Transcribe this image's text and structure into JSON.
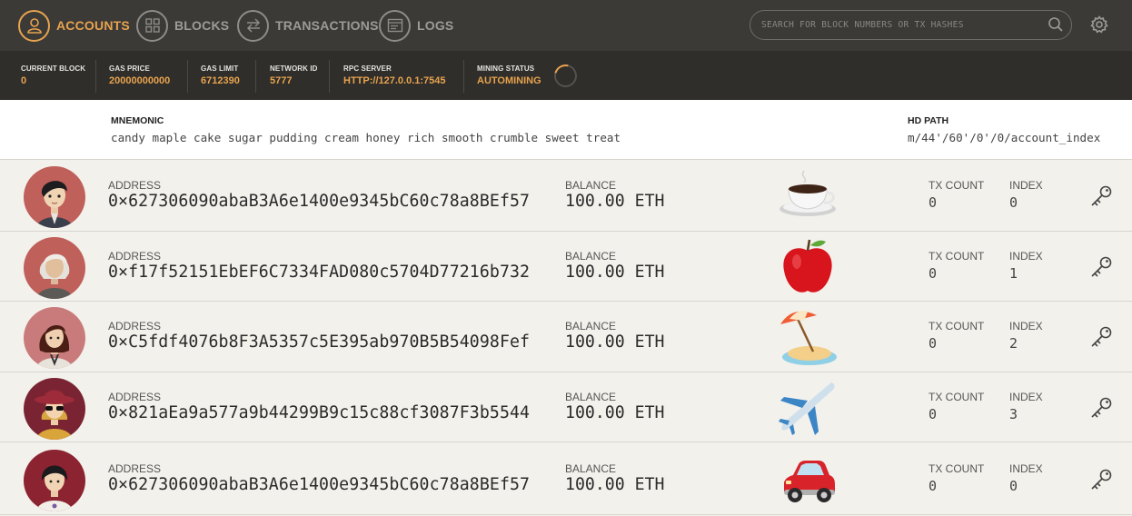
{
  "nav": {
    "accounts": "ACCOUNTS",
    "blocks": "BLOCKS",
    "transactions": "TRANSACTIONS",
    "logs": "LOGS",
    "search_placeholder": "SEARCH FOR BLOCK NUMBERS OR TX HASHES",
    "accent_color": "#e8a34e"
  },
  "status": {
    "current_block": {
      "label": "CURRENT BLOCK",
      "value": "0"
    },
    "gas_price": {
      "label": "GAS PRICE",
      "value": "20000000000"
    },
    "gas_limit": {
      "label": "GAS LIMIT",
      "value": "6712390"
    },
    "network_id": {
      "label": "NETWORK ID",
      "value": "5777"
    },
    "rpc_server": {
      "label": "RPC SERVER",
      "value": "HTTP://127.0.0.1:7545"
    },
    "mining_status": {
      "label": "MINING STATUS",
      "value": "AUTOMINING"
    }
  },
  "mnemonic": {
    "label": "MNEMONIC",
    "value": "candy maple cake sugar pudding cream honey rich smooth crumble sweet treat",
    "hd_label": "HD PATH",
    "hd_value": "m/44'/60'/0'/0/account_index"
  },
  "labels": {
    "address": "ADDRESS",
    "balance": "BALANCE",
    "tx_count": "TX COUNT",
    "index": "INDEX"
  },
  "accounts": [
    {
      "address": "0×627306090abaB3A6e1400e9345bC60c78a8BEf57",
      "balance": "100.00 ETH",
      "tx_count": "0",
      "index": "0",
      "emoji_icon": "coffee-icon",
      "avatar_bg": "#c0605a"
    },
    {
      "address": "0×f17f52151EbEF6C7334FAD080c5704D77216b732",
      "balance": "100.00 ETH",
      "tx_count": "0",
      "index": "1",
      "emoji_icon": "apple-icon",
      "avatar_bg": "#c0605a"
    },
    {
      "address": "0×C5fdf4076b8F3A5357c5E395ab970B5B54098Fef",
      "balance": "100.00 ETH",
      "tx_count": "0",
      "index": "2",
      "emoji_icon": "beach-umbrella-icon",
      "avatar_bg": "#c97b7b"
    },
    {
      "address": "0×821aEa9a577a9b44299B9c15c88cf3087F3b5544",
      "balance": "100.00 ETH",
      "tx_count": "0",
      "index": "3",
      "emoji_icon": "airplane-icon",
      "avatar_bg": "#7a2433"
    },
    {
      "address": "0×627306090abaB3A6e1400e9345bC60c78a8BEf57",
      "balance": "100.00 ETH",
      "tx_count": "0",
      "index": "0",
      "emoji_icon": "car-icon",
      "avatar_bg": "#8c2330"
    }
  ]
}
